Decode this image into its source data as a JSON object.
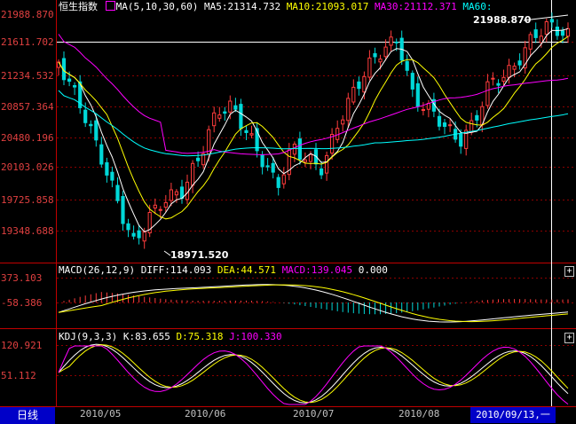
{
  "main_panel": {
    "title": "恒生指数",
    "ma_label": "MA(5,10,30,60)",
    "ma5": "MA5:21314.732",
    "ma10": "MA10:21093.017",
    "ma30": "MA30:21112.371",
    "ma60": "MA60:",
    "y_ticks": [
      "21988.870",
      "21611.702",
      "21234.532",
      "20857.364",
      "20480.196",
      "20103.026",
      "19725.858",
      "19348.688"
    ],
    "high_label": "21988.870",
    "low_label": "18971.520"
  },
  "macd_panel": {
    "params": "MACD(26,12,9)",
    "diff": "DIFF:114.093",
    "dea": "DEA:44.571",
    "macd": "MACD:139.045",
    "extra": "0.000",
    "y_ticks": [
      "373.103",
      "-58.386"
    ]
  },
  "kdj_panel": {
    "params": "KDJ(9,3,3)",
    "k": "K:83.655",
    "d": "D:75.318",
    "j": "J:100.330",
    "y_ticks": [
      "120.921",
      "51.112"
    ]
  },
  "footer": {
    "period_tab": "日线",
    "dates": [
      "2010/05",
      "2010/06",
      "2010/07",
      "2010/08"
    ],
    "cursor_date": "2010/09/13,一"
  },
  "buttons": {
    "expand": "+"
  },
  "colors": {
    "up": "#ff3c3c",
    "down": "#00d8d8",
    "ma5": "#ffffff",
    "ma10": "#ffff00",
    "ma30": "#ff00ff",
    "ma60": "#00ffff",
    "grid": "#8b0000"
  }
}
